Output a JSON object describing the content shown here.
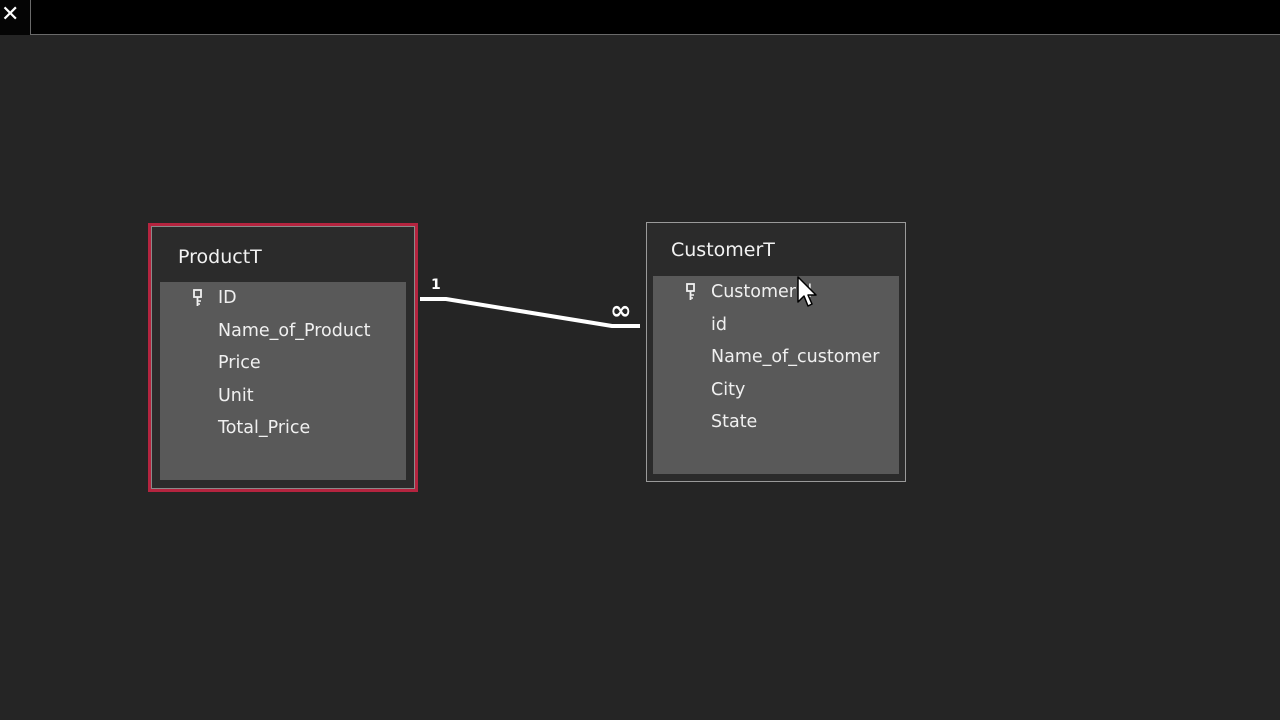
{
  "window": {
    "close_glyph": "✕"
  },
  "tables": {
    "product": {
      "title": "ProductT",
      "fields": [
        {
          "name": "ID",
          "primary_key": true
        },
        {
          "name": "Name_of_Product",
          "primary_key": false
        },
        {
          "name": "Price",
          "primary_key": false
        },
        {
          "name": "Unit",
          "primary_key": false
        },
        {
          "name": "Total_Price",
          "primary_key": false
        }
      ]
    },
    "customer": {
      "title": "CustomerT",
      "fields": [
        {
          "name": "CustomerId",
          "primary_key": true
        },
        {
          "name": "id",
          "primary_key": false
        },
        {
          "name": "Name_of_customer",
          "primary_key": false
        },
        {
          "name": "City",
          "primary_key": false
        },
        {
          "name": "State",
          "primary_key": false
        }
      ]
    }
  },
  "relationship": {
    "one_label": "1",
    "many_label": "∞"
  },
  "colors": {
    "selected_border": "#b5243f",
    "canvas": "#252525",
    "field_area": "#595959"
  },
  "icons": {
    "close": "close-icon",
    "key": "key-icon",
    "cursor": "mouse-pointer-icon"
  }
}
